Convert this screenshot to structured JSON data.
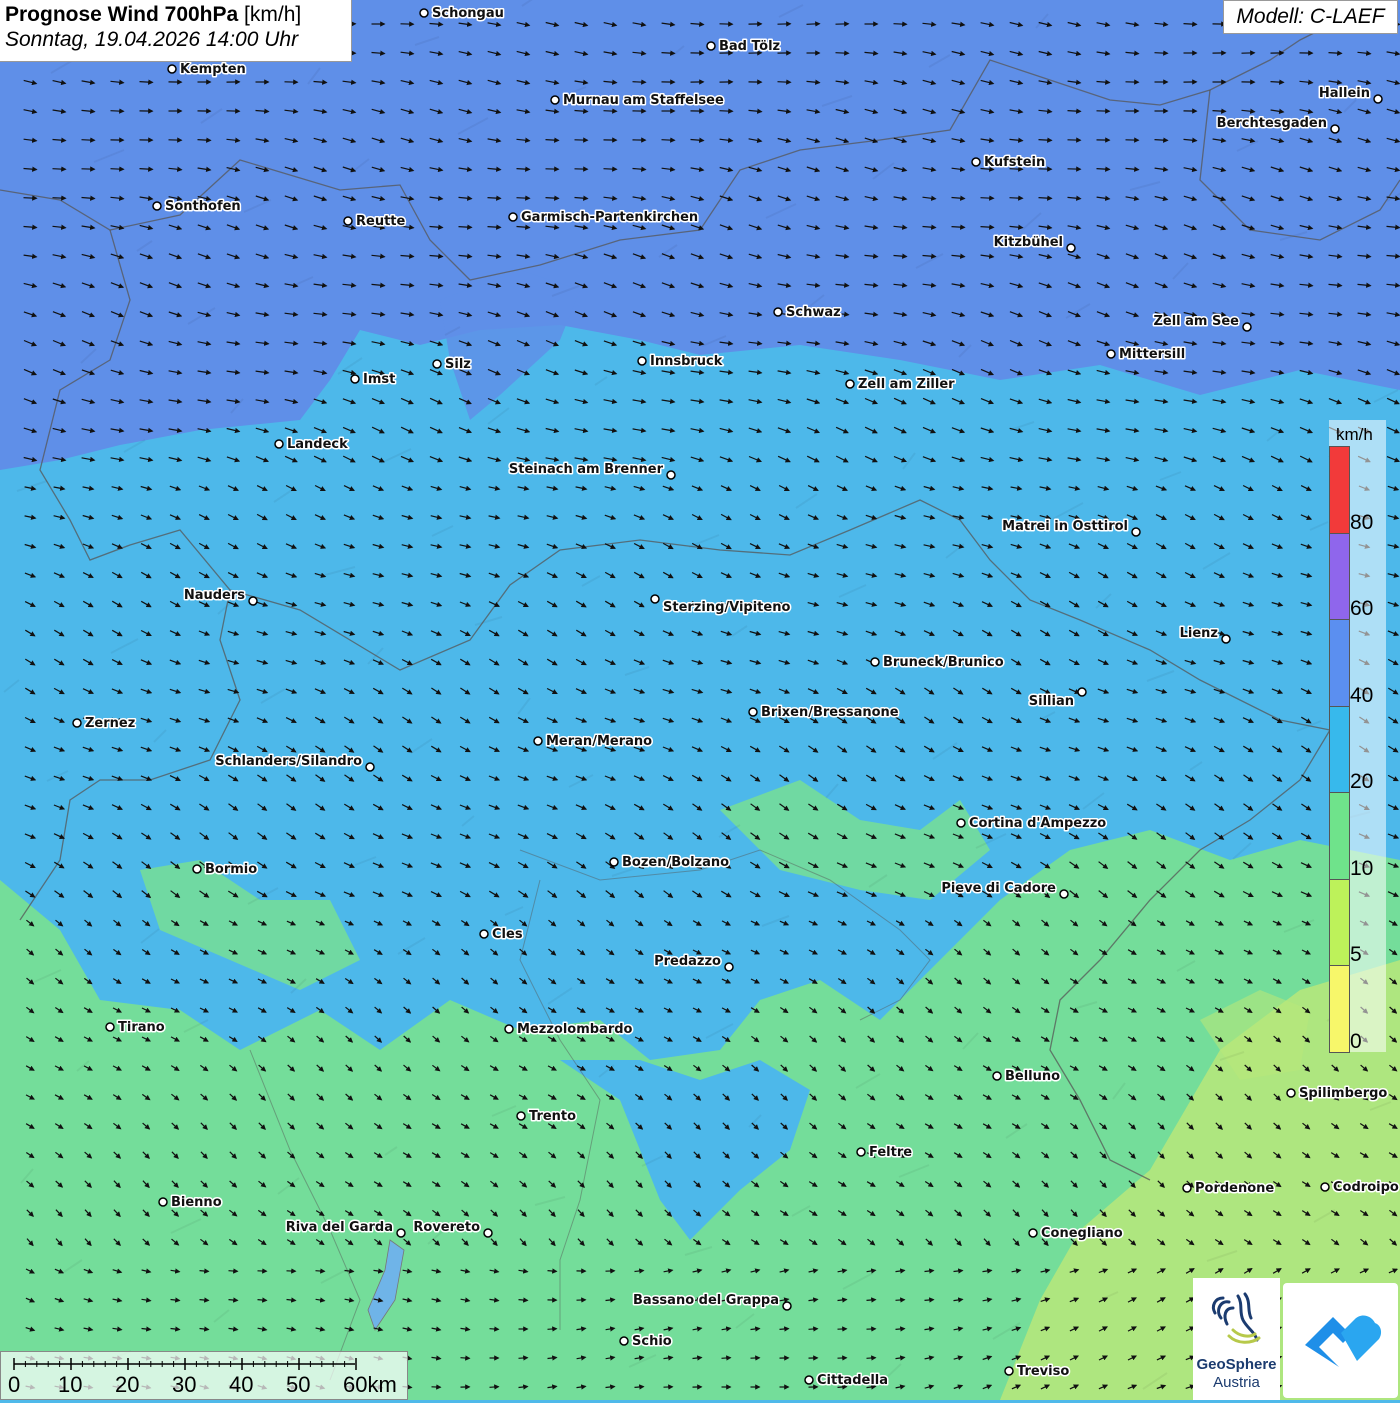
{
  "title": {
    "main": "Prognose Wind 700hPa",
    "unit": "[km/h]",
    "datetime": "Sonntag, 19.04.2026 14:00 Uhr"
  },
  "model": "Modell: C-LAEF",
  "legend": {
    "unit": "km/h",
    "ticks": [
      "80",
      "60",
      "40",
      "20",
      "10",
      "5",
      "0"
    ],
    "colors": [
      "#f23a3a",
      "#8f66ec",
      "#5b8ff0",
      "#37b9ec",
      "#6fe38b",
      "#bdf25a",
      "#f7f76a"
    ]
  },
  "scalebar": {
    "labels": [
      "0",
      "10",
      "20",
      "30",
      "40",
      "50",
      "60km"
    ]
  },
  "logos": {
    "geosphere_line1": "GeoSphere",
    "geosphere_line2": "Austria"
  },
  "cities": [
    {
      "name": "Schongau"
    },
    {
      "name": "Bad Tölz"
    },
    {
      "name": "Kempten"
    },
    {
      "name": "Murnau am Staffelsee"
    },
    {
      "name": "Hallein"
    },
    {
      "name": "Berchtesgaden"
    },
    {
      "name": "Kufstein"
    },
    {
      "name": "Sonthofen"
    },
    {
      "name": "Reutte"
    },
    {
      "name": "Garmisch-Partenkirchen"
    },
    {
      "name": "Kitzbühel"
    },
    {
      "name": "Schwaz"
    },
    {
      "name": "Zell am See"
    },
    {
      "name": "Innsbruck"
    },
    {
      "name": "Mittersill"
    },
    {
      "name": "Silz"
    },
    {
      "name": "Imst"
    },
    {
      "name": "Zell am Ziller"
    },
    {
      "name": "Landeck"
    },
    {
      "name": "Steinach am Brenner"
    },
    {
      "name": "Matrei in Osttirol"
    },
    {
      "name": "Nauders"
    },
    {
      "name": "Sterzing/Vipiteno"
    },
    {
      "name": "Lienz"
    },
    {
      "name": "Bruneck/Brunico"
    },
    {
      "name": "Sillian"
    },
    {
      "name": "Brixen/Bressanone"
    },
    {
      "name": "Zernez"
    },
    {
      "name": "Meran/Merano"
    },
    {
      "name": "Schlanders/Silandro"
    },
    {
      "name": "Cortina d'Ampezzo"
    },
    {
      "name": "Bozen/Bolzano"
    },
    {
      "name": "Bormio"
    },
    {
      "name": "Pieve di Cadore"
    },
    {
      "name": "Cles"
    },
    {
      "name": "Predazzo"
    },
    {
      "name": "Tirano"
    },
    {
      "name": "Mezzolombardo"
    },
    {
      "name": "Belluno"
    },
    {
      "name": "Spilimbergo"
    },
    {
      "name": "Trento"
    },
    {
      "name": "Feltre"
    },
    {
      "name": "Bienno"
    },
    {
      "name": "Pordenone"
    },
    {
      "name": "Codroipo"
    },
    {
      "name": "Riva del Garda"
    },
    {
      "name": "Rovereto"
    },
    {
      "name": "Conegliano"
    },
    {
      "name": "Bassano del Grappa"
    },
    {
      "name": "Schio"
    },
    {
      "name": "Treviso"
    },
    {
      "name": "Cittadella"
    }
  ]
}
